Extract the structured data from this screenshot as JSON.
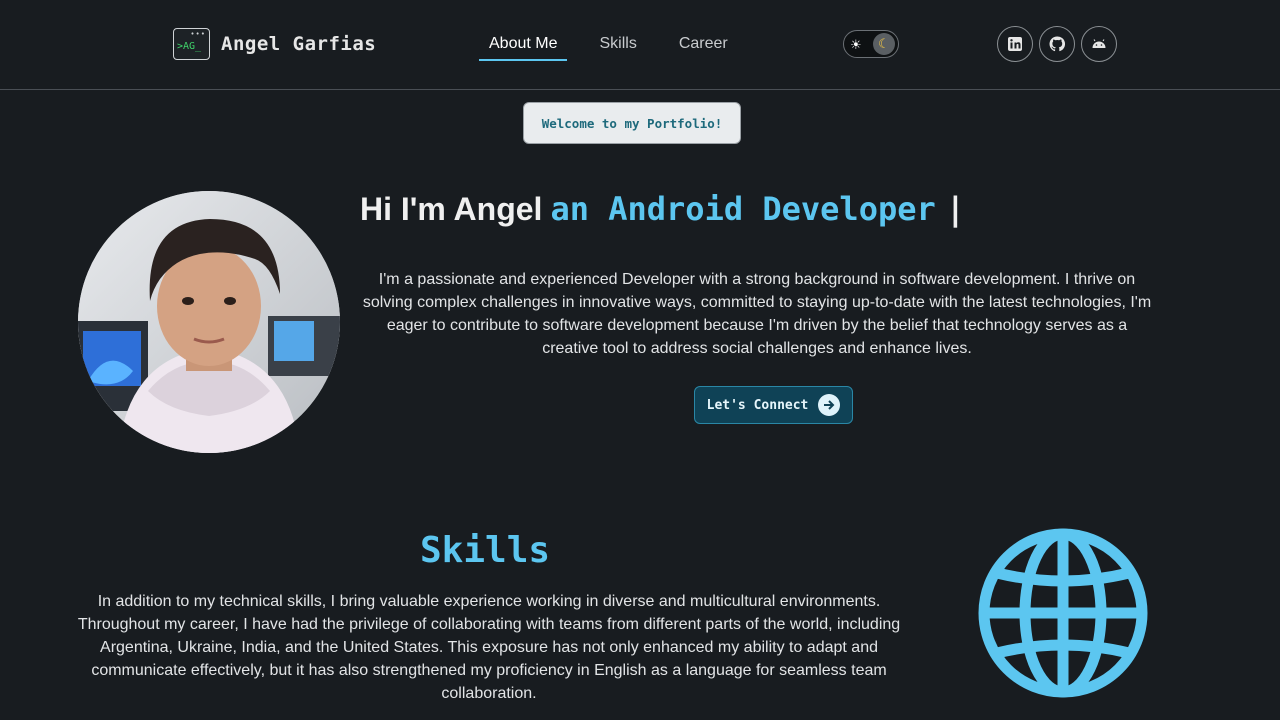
{
  "brand": {
    "logo_text": ">AG_",
    "name": "Angel Garfias"
  },
  "nav": {
    "links": [
      {
        "label": "About Me",
        "active": true
      },
      {
        "label": "Skills",
        "active": false
      },
      {
        "label": "Career",
        "active": false
      }
    ]
  },
  "theme_toggle": {
    "sun_icon": "sun-icon",
    "moon_icon": "moon-icon",
    "mode": "dark"
  },
  "socials": [
    {
      "icon": "linkedin-icon"
    },
    {
      "icon": "github-icon"
    },
    {
      "icon": "android-icon"
    }
  ],
  "welcome": {
    "label": "Welcome to my Portfolio!"
  },
  "hero": {
    "greeting": "Hi I'm Angel",
    "role": "an Android Developer",
    "cursor": "|",
    "description": "I'm a passionate and experienced Developer with a strong background in software development. I thrive on solving complex challenges in innovative ways, committed to staying up-to-date with the latest technologies, I'm eager to contribute to software development because I'm driven by the belief that technology serves as a creative tool to address social challenges and enhance lives.",
    "connect_label": "Let's Connect"
  },
  "skills": {
    "title": "Skills",
    "description": "In addition to my technical skills, I bring valuable experience working in diverse and multicultural environments. Throughout my career, I have had the privilege of collaborating with teams from different parts of the world, including Argentina, Ukraine, India, and the United States. This exposure has not only enhanced my ability to adapt and communicate effectively, but it has also strengthened my proficiency in English as a language for seamless team collaboration.",
    "icon": "globe-icon"
  },
  "colors": {
    "background": "#181c20",
    "accent": "#5cc6f0",
    "button": "#0f4256"
  }
}
